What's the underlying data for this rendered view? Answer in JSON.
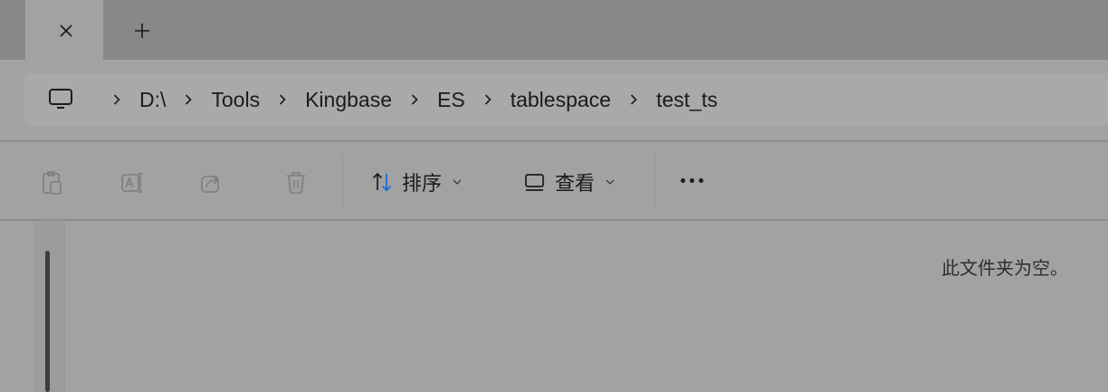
{
  "tabs": {
    "close_icon": "close-icon",
    "new_tab_icon": "plus-icon"
  },
  "breadcrumb": {
    "root_icon": "computer-monitor-icon",
    "items": [
      "D:\\",
      "Tools",
      "Kingbase",
      "ES",
      "tablespace",
      "test_ts"
    ]
  },
  "toolbar": {
    "icons": [
      "paste-icon",
      "rename-icon",
      "share-icon",
      "delete-icon"
    ],
    "sort_label": "排序",
    "view_label": "查看",
    "more_icon": "more-icon",
    "sort_icon_color": "#1f6fd1"
  },
  "main": {
    "empty_message": "此文件夹为空。"
  }
}
